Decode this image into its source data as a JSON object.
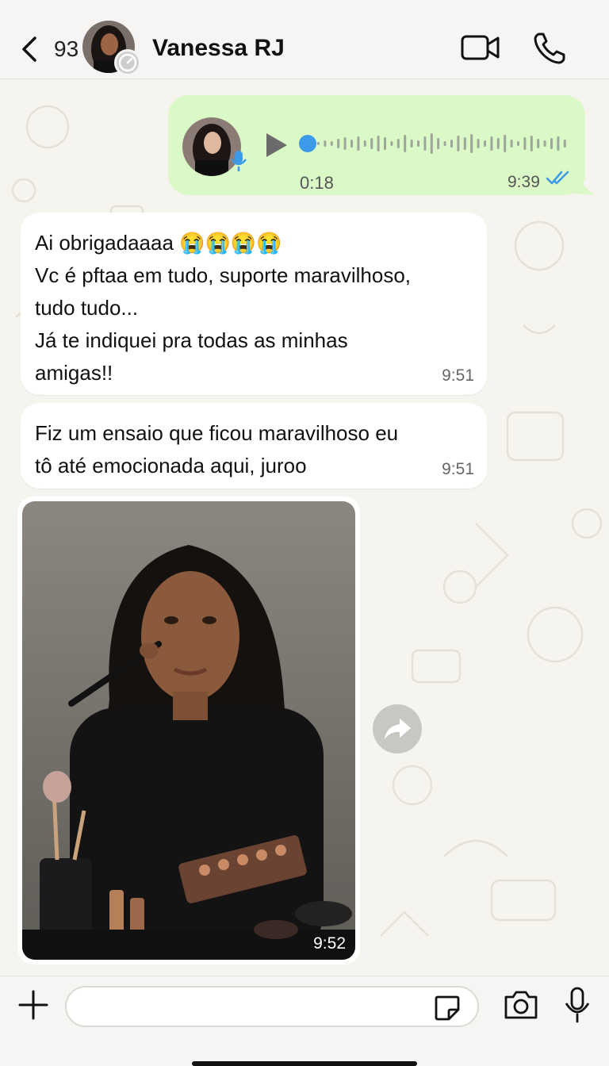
{
  "header": {
    "unread_count": "93",
    "contact_name": "Vanessa RJ",
    "icons": {
      "back": "chevron-left-icon",
      "video": "video-camera-icon",
      "call": "phone-icon"
    }
  },
  "messages": {
    "voice": {
      "duration": "0:18",
      "time": "9:39",
      "status": "read",
      "progress": 0
    },
    "text_1": {
      "text": "Ai obrigadaaaa 😭😭😭😭\nVc é pftaa em tudo, suporte maravilhoso,\ntudo tudo...\nJá te indiquei pra todas as minhas\namigas!!",
      "time": "9:51"
    },
    "text_2": {
      "text": "Fiz um ensaio que ficou maravilhoso eu\ntô até emocionada aqui, juroo",
      "time": "9:51"
    },
    "image": {
      "time": "9:52"
    }
  },
  "input": {
    "placeholder": "",
    "value": ""
  },
  "colors": {
    "outgoing_bubble": "#dbf8c7",
    "incoming_bubble": "#ffffff",
    "accent_blue": "#3d9ae8",
    "wallpaper": "#f6f4ee"
  }
}
